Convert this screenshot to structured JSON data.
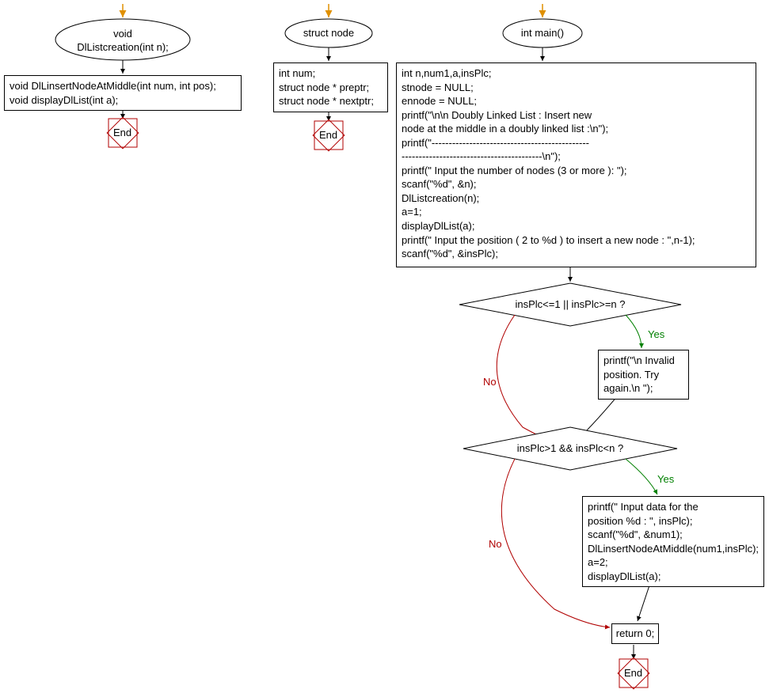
{
  "flow1": {
    "start": "void DlListcreation(int n);",
    "box": "void DlLinsertNodeAtMiddle(int num, int pos);\nvoid displayDlList(int a);",
    "end": "End"
  },
  "flow2": {
    "start": "struct node",
    "box": "int num;\nstruct node * preptr;\nstruct node * nextptr;",
    "end": "End"
  },
  "flow3": {
    "start": "int main()",
    "box1": "int n,num1,a,insPlc;\nstnode = NULL;\nennode = NULL;\nprintf(\"\\n\\n Doubly Linked List : Insert new\nnode at the middle in a doubly linked list :\\n\");\nprintf(\"----------------------------------------------\n-----------------------------------------\\n\");\nprintf(\" Input the number of nodes (3 or more ): \");\nscanf(\"%d\", &n);\nDlListcreation(n);\na=1;\ndisplayDlList(a);\nprintf(\" Input the position ( 2 to %d ) to insert a new node : \",n-1);\nscanf(\"%d\", &insPlc);",
    "cond1": "insPlc<=1 || insPlc>=n ?",
    "yes1": "Yes",
    "no1": "No",
    "box2": "printf(\"\\n Invalid\nposition. Try\nagain.\\n \");",
    "cond2": "insPlc>1 && insPlc<n ?",
    "yes2": "Yes",
    "no2": "No",
    "box3": "printf(\" Input data for the\nposition %d : \", insPlc);\nscanf(\"%d\", &num1);\nDlLinsertNodeAtMiddle(num1,insPlc);\na=2;\ndisplayDlList(a);",
    "box4": "return 0;",
    "end": "End"
  }
}
